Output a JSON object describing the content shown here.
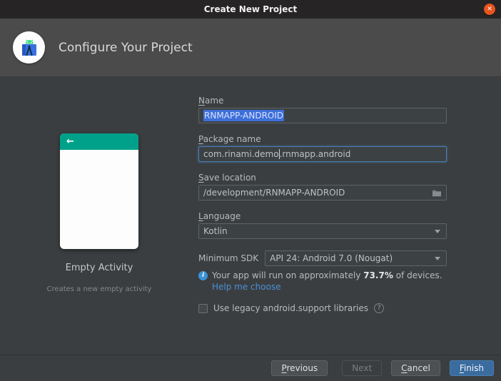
{
  "titlebar": {
    "title": "Create New Project",
    "close_glyph": "✕"
  },
  "header": {
    "title": "Configure Your Project"
  },
  "preview": {
    "back_glyph": "←",
    "title": "Empty Activity",
    "subtitle": "Creates a new empty activity"
  },
  "form": {
    "name_field": {
      "label_mnemonic": "N",
      "label_rest": "ame",
      "value": "RNMAPP-ANDROID"
    },
    "package_field": {
      "label_mnemonic": "P",
      "label_rest": "ackage name",
      "value_before_caret": "com.rinami.demo",
      "value_after_caret": ".rnmapp.android"
    },
    "location_field": {
      "label_mnemonic": "S",
      "label_rest": "ave location",
      "value": "/development/RNMAPP-ANDROID"
    },
    "language_field": {
      "label_mnemonic": "L",
      "label_rest": "anguage",
      "value": "Kotlin"
    },
    "min_sdk_field": {
      "label": "Minimum SDK",
      "value": "API 24: Android 7.0 (Nougat)"
    },
    "sdk_info": {
      "info_glyph": "i",
      "text_before": "Your app will run on approximately ",
      "percent": "73.7%",
      "text_after": " of devices.",
      "link": "Help me choose"
    },
    "legacy_checkbox": {
      "label": "Use legacy android.support libraries",
      "help_glyph": "?"
    }
  },
  "footer": {
    "previous_mnemonic": "P",
    "previous_rest": "revious",
    "next_label": "Next",
    "cancel_mnemonic": "C",
    "cancel_rest": "ancel",
    "finish_mnemonic": "F",
    "finish_rest": "inish"
  },
  "colors": {
    "selection_blue": "#3d6fd9",
    "focus_border_blue": "#4a7db3",
    "link_blue": "#4a90d9",
    "info_blue": "#3b92d6",
    "finish_button_blue": "#3a6ca0",
    "preview_teal": "#00a18a",
    "close_button_red": "#e9541f",
    "panel_background": "#3b3e40",
    "header_background": "#4b4b4b",
    "titlebar_background": "#262424"
  }
}
